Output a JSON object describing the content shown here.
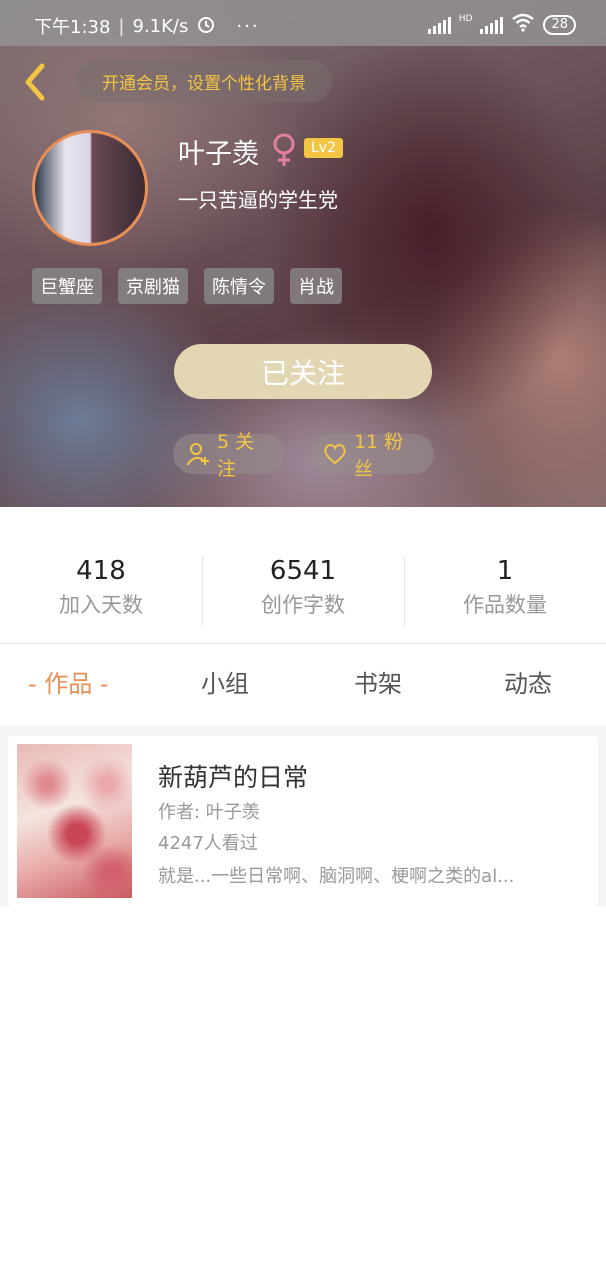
{
  "status_bar": {
    "time": "下午1:38",
    "speed": "9.1K/s",
    "more": "···",
    "hd": "HD",
    "battery": "28"
  },
  "header": {
    "vip_promo": "开通会员，设置个性化背景"
  },
  "profile": {
    "username": "叶子羡",
    "gender_symbol": "♀",
    "level": "Lv2",
    "bio": "一只苦逼的学生党",
    "tags": [
      "巨蟹座",
      "京剧猫",
      "陈情令",
      "肖战"
    ],
    "follow_button": "已关注",
    "following": "5 关注",
    "followers": "11 粉丝"
  },
  "stats": [
    {
      "value": "418",
      "label": "加入天数"
    },
    {
      "value": "6541",
      "label": "创作字数"
    },
    {
      "value": "1",
      "label": "作品数量"
    }
  ],
  "tabs": [
    {
      "label": "- 作品 -",
      "active": true
    },
    {
      "label": "小组",
      "active": false
    },
    {
      "label": "书架",
      "active": false
    },
    {
      "label": "动态",
      "active": false
    }
  ],
  "works": [
    {
      "title": "新葫芦的日常",
      "author": "作者: 叶子羡",
      "views": "4247人看过",
      "summary": "就是...一些日常啊、脑洞啊、梗啊之类的al..."
    }
  ],
  "colors": {
    "accent": "#e88f57",
    "gold": "#f3c544",
    "follow_button_bg": "#e2d6b3"
  }
}
